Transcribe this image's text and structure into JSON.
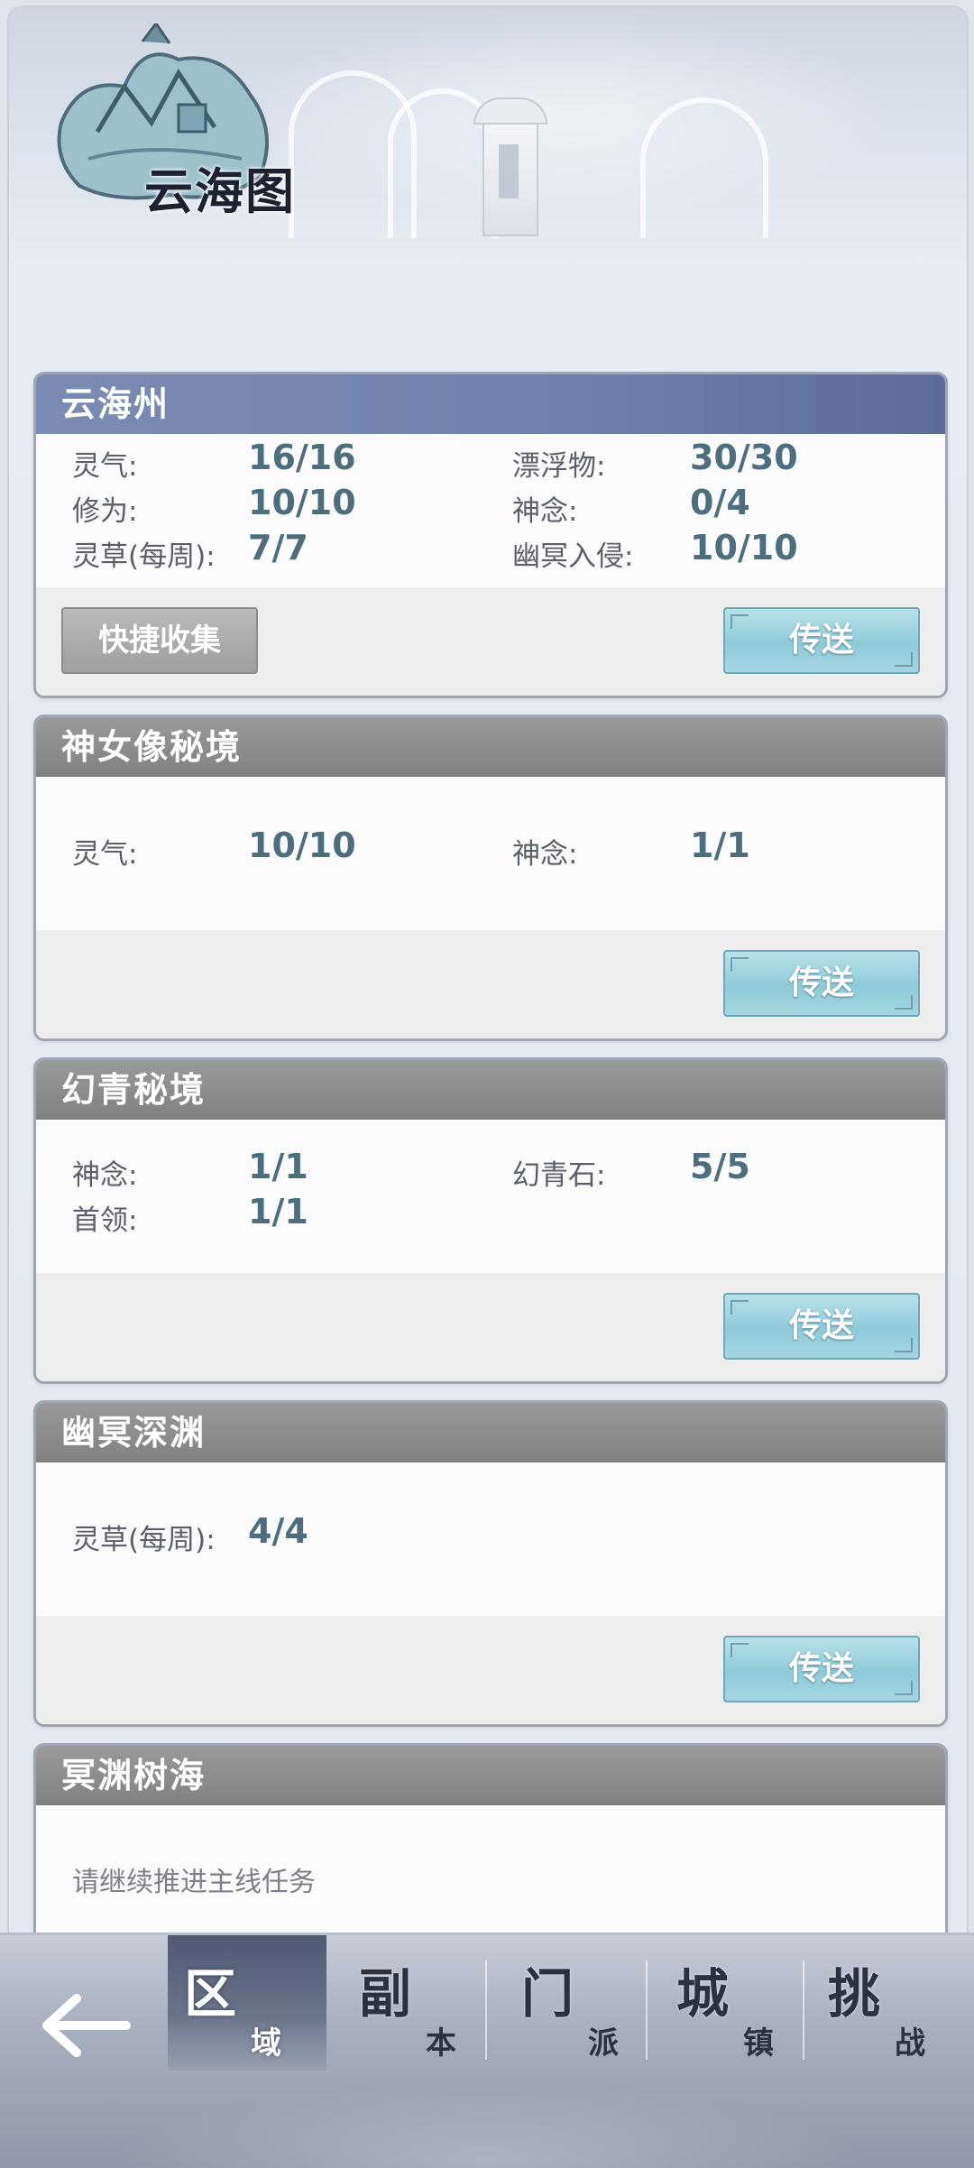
{
  "header": {
    "title": "云海图"
  },
  "cards": [
    {
      "name": "云海州",
      "stats": [
        {
          "label": "灵气:",
          "value": "16/16"
        },
        {
          "label": "漂浮物:",
          "value": "30/30"
        },
        {
          "label": "修为:",
          "value": "10/10"
        },
        {
          "label": "神念:",
          "value": "0/4"
        },
        {
          "label": "灵草(每周):",
          "value": "7/7"
        },
        {
          "label": "幽冥入侵:",
          "value": "10/10"
        }
      ],
      "quick_label": "快捷收集",
      "teleport_label": "传送"
    },
    {
      "name": "神女像秘境",
      "stats": [
        {
          "label": "灵气:",
          "value": "10/10"
        },
        {
          "label": "神念:",
          "value": "1/1"
        }
      ],
      "teleport_label": "传送"
    },
    {
      "name": "幻青秘境",
      "stats": [
        {
          "label": "神念:",
          "value": "1/1"
        },
        {
          "label": "幻青石:",
          "value": "5/5"
        },
        {
          "label": "首领:",
          "value": "1/1"
        }
      ],
      "teleport_label": "传送"
    },
    {
      "name": "幽冥深渊",
      "stats": [
        {
          "label": "灵草(每周):",
          "value": "4/4"
        }
      ],
      "teleport_label": "传送"
    },
    {
      "name": "冥渊树海",
      "hint": "请继续推进主线任务"
    }
  ],
  "nav": {
    "tabs": [
      {
        "big": "区",
        "small": "域"
      },
      {
        "big": "副",
        "small": "本"
      },
      {
        "big": "门",
        "small": "派"
      },
      {
        "big": "城",
        "small": "镇"
      },
      {
        "big": "挑",
        "small": "战"
      }
    ]
  }
}
